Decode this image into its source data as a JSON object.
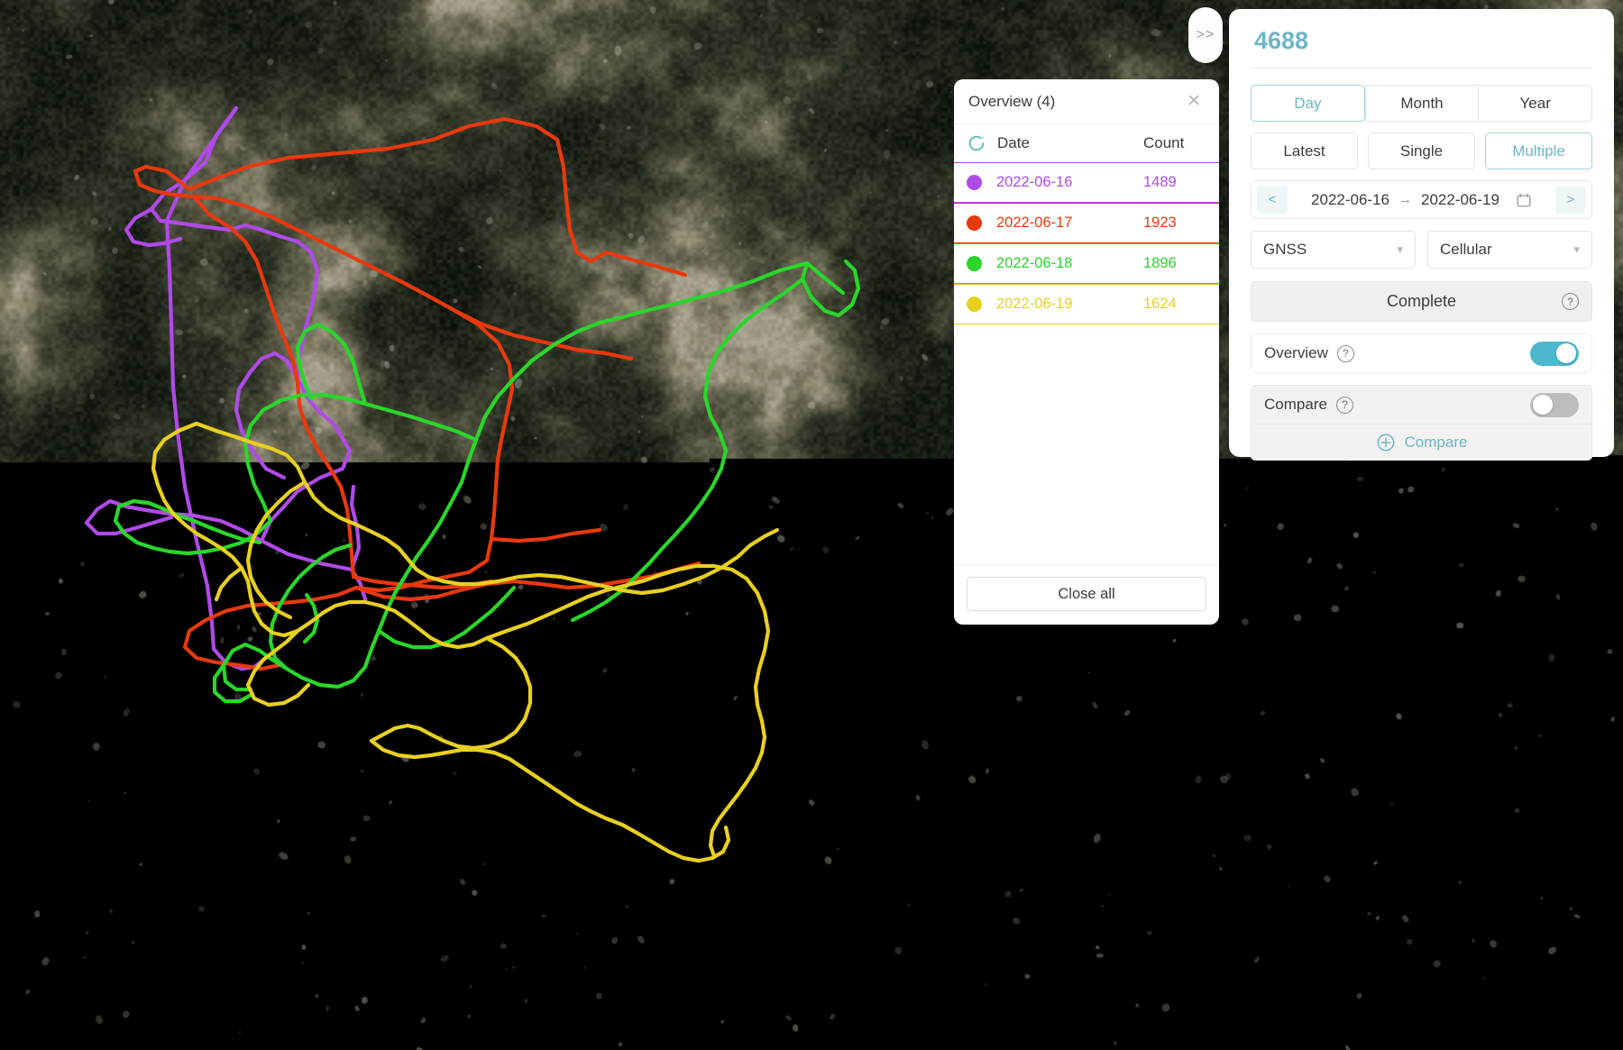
{
  "map": {
    "type": "satellite-imagery",
    "base_colors": [
      "#30352c",
      "#1d2319",
      "#6d6c56",
      "#9a9782"
    ],
    "tracks": [
      {
        "date": "2022-06-16",
        "color": "#b04ae8",
        "label": "purple-track"
      },
      {
        "date": "2022-06-17",
        "color": "#e8390d",
        "label": "red-track"
      },
      {
        "date": "2022-06-18",
        "color": "#2ad62a",
        "label": "green-track"
      },
      {
        "date": "2022-06-19",
        "color": "#e8d020",
        "label": "yellow-track"
      }
    ]
  },
  "collapse_handle": {
    "label": ">>",
    "icon": "chevron-double-right-icon"
  },
  "overview": {
    "title": "Overview (4)",
    "close_icon": "close-icon",
    "refresh_icon": "refresh-icon",
    "columns": {
      "date": "Date",
      "count": "Count"
    },
    "rows": [
      {
        "date": "2022-06-16",
        "count": "1489",
        "color": "#b04ae8",
        "selected": true
      },
      {
        "date": "2022-06-17",
        "count": "1923",
        "color": "#e8390d",
        "selected": false
      },
      {
        "date": "2022-06-18",
        "count": "1896",
        "color": "#2ad62a",
        "selected": false
      },
      {
        "date": "2022-06-19",
        "count": "1624",
        "color": "#e8d020",
        "selected": false
      }
    ],
    "close_all_label": "Close all"
  },
  "control_panel": {
    "device_id": "4688",
    "accent_color": "#6cb6c4",
    "period_tabs": [
      {
        "label": "Day",
        "active": true
      },
      {
        "label": "Month",
        "active": false
      },
      {
        "label": "Year",
        "active": false
      }
    ],
    "selection_modes": [
      {
        "label": "Latest",
        "active": false
      },
      {
        "label": "Single",
        "active": false
      },
      {
        "label": "Multiple",
        "active": true
      }
    ],
    "date_range": {
      "prev_label": "<",
      "next_label": ">",
      "start": "2022-06-16",
      "arrow": "→",
      "end": "2022-06-19",
      "calendar_icon": "calendar-icon"
    },
    "selects": [
      {
        "name": "positioning-source",
        "value": "GNSS",
        "chevron": "chevron-down-icon"
      },
      {
        "name": "network-type",
        "value": "Cellular",
        "chevron": "chevron-down-icon"
      }
    ],
    "complete": {
      "label": "Complete",
      "help": "?"
    },
    "overview_toggle": {
      "label": "Overview",
      "help": "?",
      "on": true
    },
    "compare_toggle": {
      "label": "Compare",
      "help": "?",
      "on": false
    },
    "add_compare": {
      "label": "Compare",
      "icon": "plus-circle-icon"
    }
  }
}
